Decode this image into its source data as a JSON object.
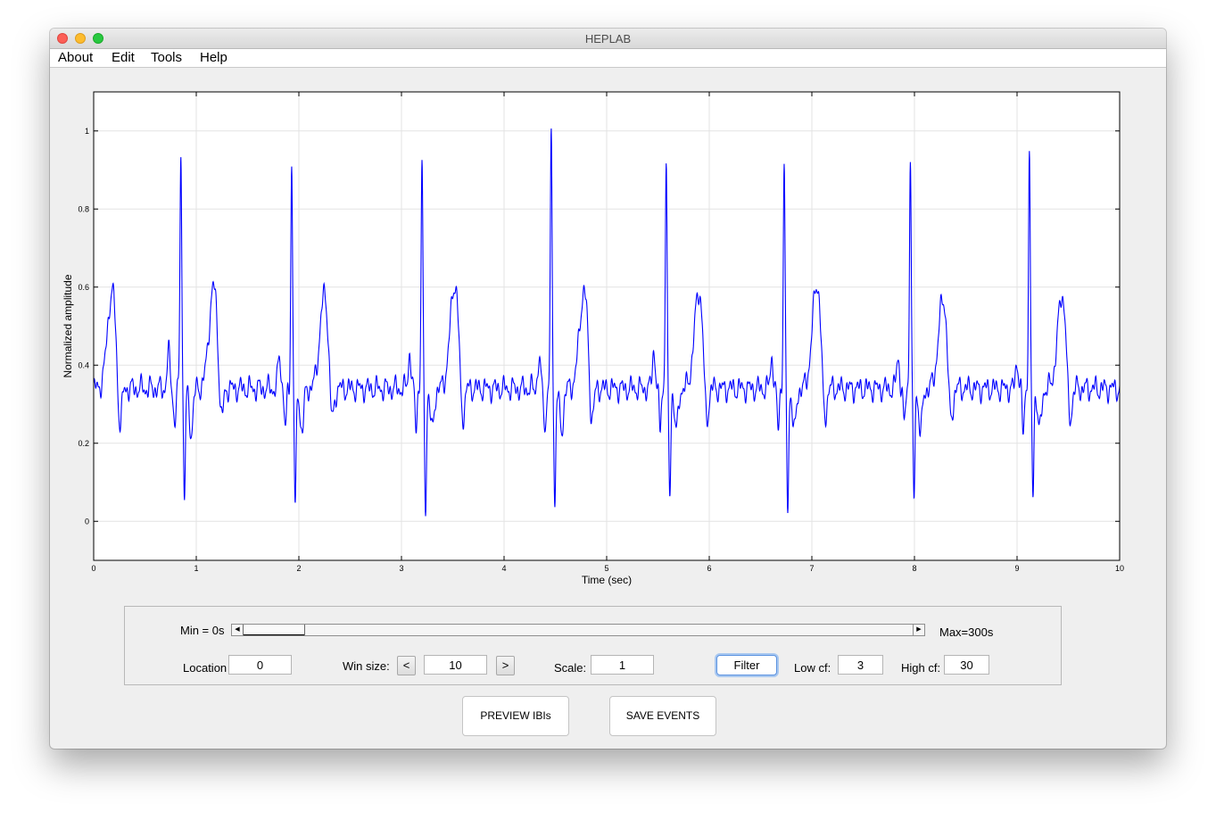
{
  "window": {
    "title": "HEPLAB"
  },
  "menu": {
    "items": [
      "About",
      "Edit",
      "Tools",
      "Help"
    ]
  },
  "controls": {
    "min_label": "Min = 0s",
    "max_label": "Max=300s",
    "slider_fraction": 0.0,
    "location_label": "Location",
    "location_value": "0",
    "winsize_label": "Win size:",
    "winsize_dec": "<",
    "winsize_value": "10",
    "winsize_inc": ">",
    "scale_label": "Scale:",
    "scale_value": "1",
    "filter_label": "Filter",
    "lowcf_label": "Low cf:",
    "lowcf_value": "3",
    "highcf_label": "High cf:",
    "highcf_value": "30"
  },
  "buttons": {
    "preview": "PREVIEW IBIs",
    "save": "SAVE EVENTS"
  },
  "chart_data": {
    "type": "line",
    "xlabel": "Time (sec)",
    "ylabel": "Normalized amplitude",
    "xlim": [
      0,
      10
    ],
    "ylim": [
      -0.1,
      1.1
    ],
    "xticks": [
      0,
      1,
      2,
      3,
      4,
      5,
      6,
      7,
      8,
      9,
      10
    ],
    "yticks": [
      0,
      0.2,
      0.4,
      0.6,
      0.8,
      1
    ],
    "grid": true,
    "line_color": "#0000ff",
    "baseline": 0.34,
    "beats": [
      {
        "t": 0.85,
        "r": 0.96,
        "s": 0.06,
        "q": 0.24,
        "p": 0.43,
        "tw": 0.6
      },
      {
        "t": 1.93,
        "r": 0.92,
        "s": 0.03,
        "q": 0.23,
        "p": 0.42,
        "tw": 0.58
      },
      {
        "t": 3.2,
        "r": 0.92,
        "s": 0.03,
        "q": 0.24,
        "p": 0.43,
        "tw": 0.61
      },
      {
        "t": 4.46,
        "r": 0.99,
        "s": 0.05,
        "q": 0.23,
        "p": 0.41,
        "tw": 0.59
      },
      {
        "t": 5.58,
        "r": 0.92,
        "s": 0.06,
        "q": 0.23,
        "p": 0.44,
        "tw": 0.59
      },
      {
        "t": 6.73,
        "r": 0.92,
        "s": 0.03,
        "q": 0.23,
        "p": 0.42,
        "tw": 0.61
      },
      {
        "t": 7.96,
        "r": 0.93,
        "s": 0.05,
        "q": 0.24,
        "p": 0.42,
        "tw": 0.57
      },
      {
        "t": 9.12,
        "r": 0.93,
        "s": 0.07,
        "q": 0.22,
        "p": 0.41,
        "tw": 0.58
      }
    ],
    "pre_beat": {
      "tw_t": 0.18,
      "tw": 0.59,
      "s_t": 0.25,
      "s": 0.19
    }
  }
}
